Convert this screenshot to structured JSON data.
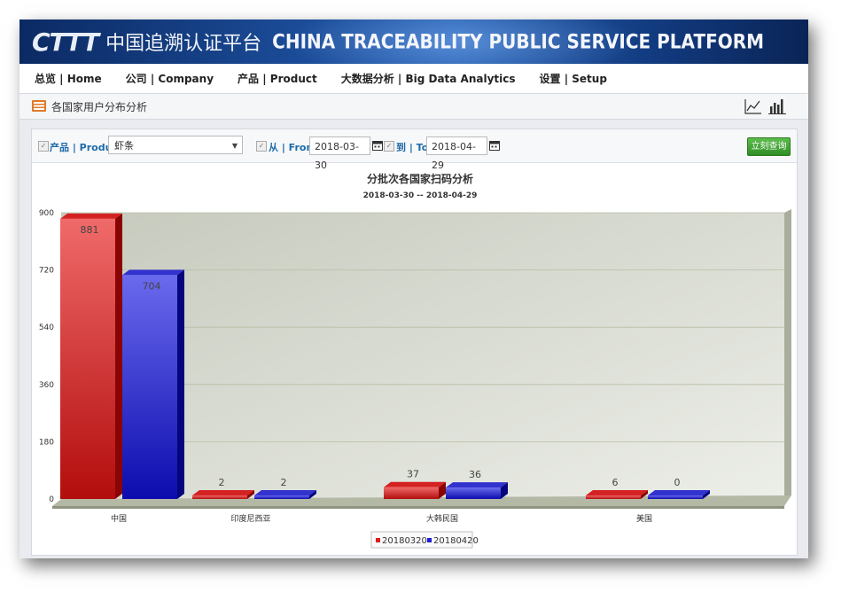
{
  "header": {
    "logo_mark": "CTTT",
    "title_cn": "中国追溯认证平台",
    "title_en": "CHINA TRACEABILITY PUBLIC SERVICE PLATFORM"
  },
  "nav": {
    "items": [
      {
        "label": "总览 | Home"
      },
      {
        "label": "公司 | Company"
      },
      {
        "label": "产品 | Product"
      },
      {
        "label": "大数据分析 | Big Data Analytics"
      },
      {
        "label": "设置 | Setup"
      }
    ]
  },
  "page": {
    "title": "各国家用户分布分析"
  },
  "filter": {
    "product_label": "产品 | Product:",
    "product_value": "虾条",
    "from_label": "从 | From:",
    "from_value": "2018-03-30",
    "to_label": "到 | To:",
    "to_value": "2018-04-29",
    "query_button": "立刻查询"
  },
  "colors": {
    "series1": "#e0191b",
    "series2": "#1e1ed8",
    "plot_bg": "#d2d6ca",
    "grid": "#b8bea6"
  },
  "chart_data": {
    "type": "bar",
    "title": "分批次各国家扫码分析",
    "subtitle": "2018-03-30 -- 2018-04-29",
    "categories": [
      "中国",
      "印度尼西亚",
      "大韩民国",
      "美国"
    ],
    "series": [
      {
        "name": "20180320",
        "values": [
          881,
          2,
          37,
          6
        ]
      },
      {
        "name": "20180420",
        "values": [
          704,
          2,
          36,
          0
        ]
      }
    ],
    "yticks": [
      0,
      180,
      360,
      540,
      720,
      900
    ],
    "ylim": [
      0,
      900
    ],
    "grid": true,
    "legend": "bottom-center"
  }
}
